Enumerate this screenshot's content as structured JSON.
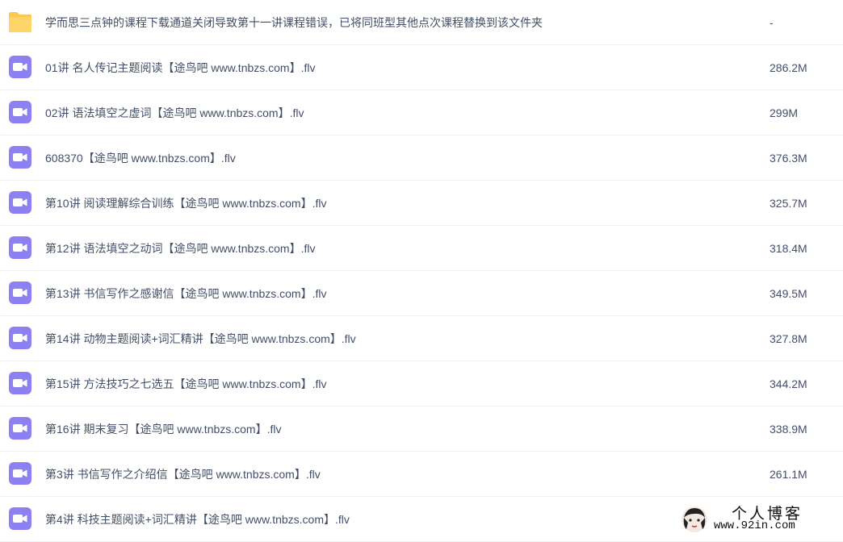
{
  "colors": {
    "folder": "#fcc94e",
    "video_icon": "#8d80f0",
    "text": "#424e67",
    "divider": "#f1f2f4"
  },
  "files": [
    {
      "icon": "folder-icon",
      "name": "学而思三点钟的课程下载通道关闭导致第十一讲课程错误，已将同班型其他点次课程替换到该文件夹",
      "size": "-"
    },
    {
      "icon": "video-file-icon",
      "name": "01讲 名人传记主题阅读【途鸟吧 www.tnbzs.com】.flv",
      "size": "286.2M"
    },
    {
      "icon": "video-file-icon",
      "name": "02讲 语法填空之虚词【途鸟吧 www.tnbzs.com】.flv",
      "size": "299M"
    },
    {
      "icon": "video-file-icon",
      "name": "608370【途鸟吧 www.tnbzs.com】.flv",
      "size": "376.3M"
    },
    {
      "icon": "video-file-icon",
      "name": "第10讲 阅读理解综合训练【途鸟吧 www.tnbzs.com】.flv",
      "size": "325.7M"
    },
    {
      "icon": "video-file-icon",
      "name": "第12讲 语法填空之动词【途鸟吧 www.tnbzs.com】.flv",
      "size": "318.4M"
    },
    {
      "icon": "video-file-icon",
      "name": "第13讲 书信写作之感谢信【途鸟吧 www.tnbzs.com】.flv",
      "size": "349.5M"
    },
    {
      "icon": "video-file-icon",
      "name": "第14讲 动物主题阅读+词汇精讲【途鸟吧 www.tnbzs.com】.flv",
      "size": "327.8M"
    },
    {
      "icon": "video-file-icon",
      "name": "第15讲 方法技巧之七选五【途鸟吧 www.tnbzs.com】.flv",
      "size": "344.2M"
    },
    {
      "icon": "video-file-icon",
      "name": "第16讲 期末复习【途鸟吧 www.tnbzs.com】.flv",
      "size": "338.9M"
    },
    {
      "icon": "video-file-icon",
      "name": "第3讲 书信写作之介绍信【途鸟吧 www.tnbzs.com】.flv",
      "size": "261.1M"
    },
    {
      "icon": "video-file-icon",
      "name": "第4讲 科技主题阅读+词汇精讲【途鸟吧 www.tnbzs.com】.flv",
      "size": ""
    }
  ],
  "watermark": {
    "title": "个人博客",
    "url": "www.92in.com"
  }
}
